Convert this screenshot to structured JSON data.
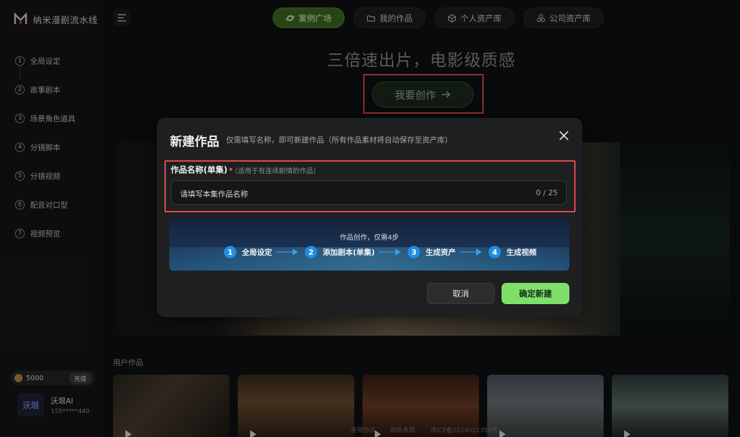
{
  "sidebar": {
    "brand": "纳米漫剧流水线",
    "steps": [
      {
        "num": "1",
        "label": "全局设定"
      },
      {
        "num": "2",
        "label": "故事剧本"
      },
      {
        "num": "3",
        "label": "场景角色道具"
      },
      {
        "num": "4",
        "label": "分镜脚本"
      },
      {
        "num": "5",
        "label": "分镜视频"
      },
      {
        "num": "6",
        "label": "配音对口型"
      },
      {
        "num": "7",
        "label": "视频预览"
      }
    ],
    "credits": "5000",
    "recharge_label": "充值",
    "user": {
      "avatar_text": "沃垠",
      "name": "沃垠AI",
      "phone": "155*****440"
    }
  },
  "topnav": {
    "tabs": [
      {
        "label": "案例广场",
        "icon": "planet-icon",
        "active": true
      },
      {
        "label": "我的作品",
        "icon": "folder-icon",
        "active": false
      },
      {
        "label": "个人资产库",
        "icon": "cube-icon",
        "active": false
      },
      {
        "label": "公司资产库",
        "icon": "shapes-icon",
        "active": false
      }
    ]
  },
  "hero": {
    "title": "三倍速出片，电影级质感",
    "create_label": "我要创作"
  },
  "modal": {
    "title": "新建作品",
    "subtitle": "仅需填写名称，即可新建作品（所有作品素材将自动保存至资产库）",
    "field_label": "作品名称(单集)",
    "required_mark": "•",
    "field_hint": "（适用于有连续剧情的作品）",
    "input_placeholder": "请填写本集作品名称",
    "counter": "0 / 25",
    "flow_title": "作品创作，仅需4步",
    "flow_steps": [
      {
        "num": "1",
        "label": "全局设定"
      },
      {
        "num": "2",
        "label": "添加剧本(单集)"
      },
      {
        "num": "3",
        "label": "生成资产"
      },
      {
        "num": "4",
        "label": "生成视频"
      }
    ],
    "cancel_label": "取消",
    "confirm_label": "确定新建"
  },
  "works": {
    "title": "用户作品"
  },
  "footer": {
    "links": [
      "使用协议",
      "隐私条款",
      "津ICP备2024022358号"
    ]
  },
  "colors": {
    "accent_green": "#7ee06b",
    "highlight_red": "#e74a4a",
    "active_tab": "#3c6b1f",
    "step_blue": "#1f8fe0"
  }
}
